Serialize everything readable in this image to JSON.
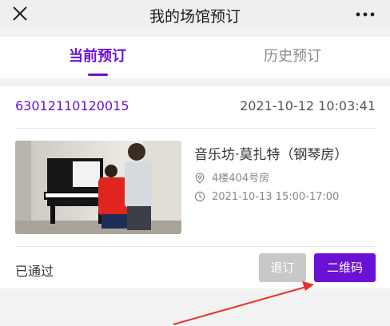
{
  "header": {
    "title": "我的场馆预订",
    "close_icon": "close-icon",
    "more_icon": "more-icon"
  },
  "tabs": [
    {
      "label": "当前预订",
      "active": true
    },
    {
      "label": "历史预订",
      "active": false
    }
  ],
  "order": {
    "number": "63012110120015",
    "created_at": "2021-10-12 10:03:41",
    "venue": "音乐坊·莫扎特（钢琴房）",
    "location": "4楼404号房",
    "schedule": "2021-10-13 15:00-17:00",
    "status": "已通过",
    "cancel_label": "退订",
    "qr_label": "二维码"
  },
  "colors": {
    "accent": "#6a11d6",
    "disabled": "#c8c8c8",
    "annotation_arrow": "#e8302a"
  }
}
